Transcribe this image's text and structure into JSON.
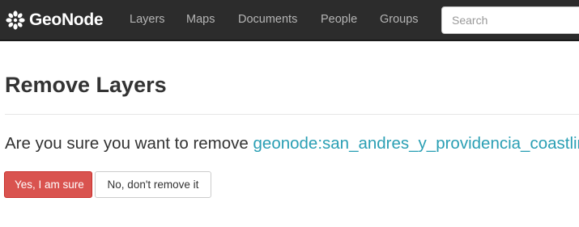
{
  "navbar": {
    "brand": "GeoNode",
    "brand_icon": "geonode-flower-icon",
    "links": [
      "Layers",
      "Maps",
      "Documents",
      "People",
      "Groups"
    ],
    "search_placeholder": "Search"
  },
  "main": {
    "title": "Remove Layers",
    "question_prefix": "Are you sure you want to remove ",
    "layer_name": "geonode:san_andres_y_providencia_coastline",
    "question_suffix": "?",
    "confirm_label": "Yes, I am sure",
    "cancel_label": "No, don't remove it"
  },
  "colors": {
    "navbar_bg": "#2c2c2c",
    "link": "#2a9fb4",
    "danger": "#d9534f"
  }
}
